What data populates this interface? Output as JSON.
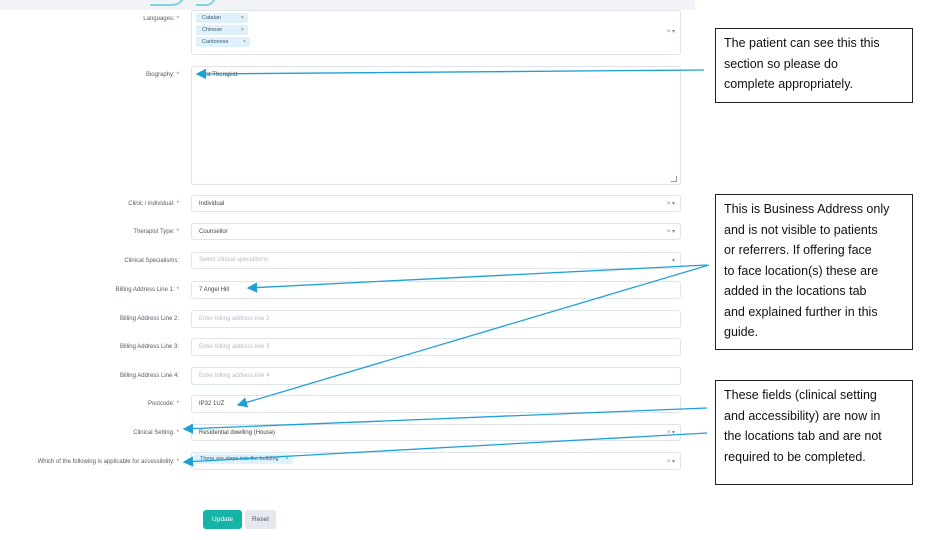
{
  "form": {
    "languages": {
      "label": "Languages:",
      "required": "*",
      "chips": [
        "Catalan",
        "Chinese",
        "Cantonese"
      ],
      "chip_remove": "×",
      "clear": "×",
      "caret": "▾"
    },
    "biography": {
      "label": "Biography:",
      "required": "*",
      "value": "st Therapist"
    },
    "clinic": {
      "label": "Clinic / individual:",
      "required": "*",
      "value": "Individual"
    },
    "therapist_type": {
      "label": "Therapist Type:",
      "required": "*",
      "value": "Counsellor"
    },
    "specialisms": {
      "label": "Clinical Specialisms:",
      "placeholder": "Select clinical specialisms"
    },
    "billing1": {
      "label": "Billing Address Line 1:",
      "required": "*",
      "value": "7 Angel Hill"
    },
    "billing2": {
      "label": "Billing Address Line 2:",
      "placeholder": "Enter billing address line 2"
    },
    "billing3": {
      "label": "Billing Address Line 3:",
      "placeholder": "Enter billing address line 3"
    },
    "billing4": {
      "label": "Billing Address Line 4:",
      "placeholder": "Enter billing address line 4"
    },
    "postcode": {
      "label": "Postcode:",
      "required": "*",
      "value": "IP32 1UZ"
    },
    "clinical_setting": {
      "label": "Clinical Setting:",
      "required": "*",
      "value": "Residential dwelling (House)"
    },
    "accessibility": {
      "label": "Which of the following is applicable for accessibility:",
      "required": "*",
      "chip": "There are steps into the building"
    },
    "buttons": {
      "update": "Update",
      "reset": "Reset"
    }
  },
  "notes": {
    "patient": [
      "The patient can see this this",
      "section so please do",
      "complete appropriately."
    ],
    "business": [
      "This is Business Address only",
      "and is not visible to patients",
      "or referrers.  If offering face",
      "to face location(s) these are",
      "added in the locations tab",
      "and explained further in this",
      "guide."
    ],
    "fields": [
      "These fields (clinical setting",
      "and accessibility) are now in",
      "the locations tab and are not",
      "required to be completed."
    ]
  },
  "colors": {
    "accent": "#17b3a8",
    "arrow": "#1ea0d6",
    "chip": "#dff1fb",
    "required": "#e0405b"
  }
}
